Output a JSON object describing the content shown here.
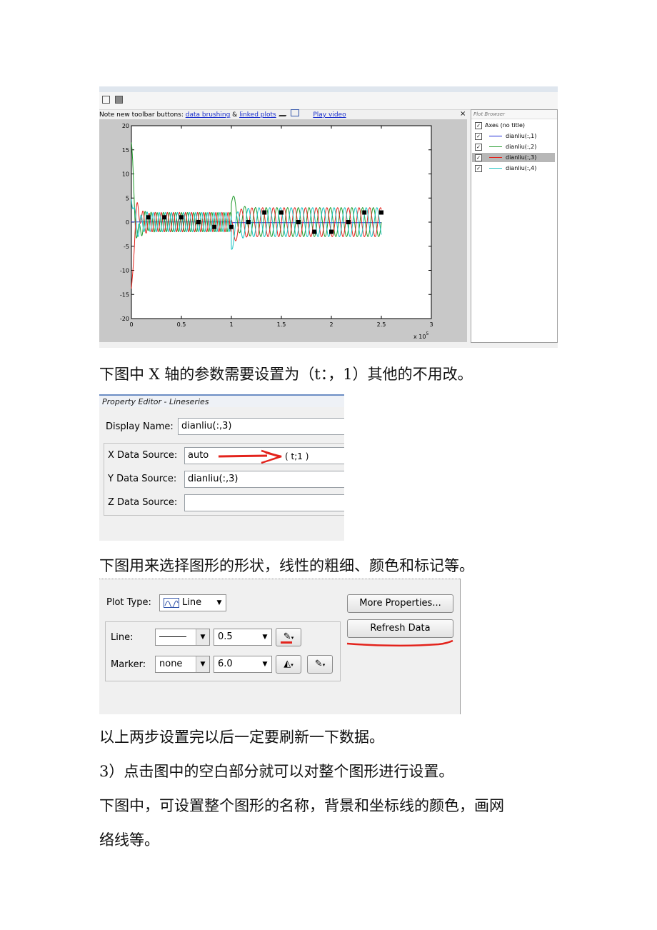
{
  "screenshot1": {
    "toolbar_note": "Note new toolbar buttons: ",
    "link_brushing": "data brushing",
    "amp": "&",
    "link_linked": "linked plots",
    "link_video": "Play video",
    "close_glyph": "×",
    "browser_title": "Plot Browser",
    "browser_items": [
      {
        "label": "Axes (no title)"
      },
      {
        "label": "dianliu(:,1)",
        "color": "#1f2bd6"
      },
      {
        "label": "dianliu(:,2)",
        "color": "#1f9a2a"
      },
      {
        "label": "dianliu(:,3)",
        "color": "#e3231c",
        "selected": true
      },
      {
        "label": "dianliu(:,4)",
        "color": "#19c2c2"
      }
    ],
    "chart_data": {
      "type": "line",
      "xlim": [
        0,
        3
      ],
      "ylim": [
        -20,
        20
      ],
      "x_ticks": [
        "0",
        "0.5",
        "1",
        "1.5",
        "2",
        "2.5",
        "3"
      ],
      "y_ticks": [
        "20",
        "15",
        "10",
        "5",
        "0",
        "-5",
        "-10",
        "-15",
        "-20"
      ],
      "x_multiplier": "x 10",
      "x_multiplier_exp": "5",
      "grid": false,
      "series": [
        {
          "name": "dianliu(:,1)",
          "color": "#1f2bd6",
          "segments": [
            [
              0,
              0.01
            ],
            [
              0.01,
              0.05
            ],
            [
              1.0,
              0.05
            ],
            [
              1.01,
              -0.1
            ],
            [
              2.5,
              -0.1
            ]
          ]
        },
        {
          "name": "dianliu(:,2)",
          "color": "#1f9a2a",
          "transient_peaks": [
            [
              0.07,
              16.5
            ],
            [
              1.05,
              6.5
            ]
          ],
          "steady_amplitude_1": 2,
          "steady_amplitude_2": 3
        },
        {
          "name": "dianliu(:,3)",
          "color": "#e3231c",
          "transient_peaks": [
            [
              0.04,
              -15.5
            ],
            [
              0.12,
              7.5
            ],
            [
              1.02,
              -3.5
            ]
          ],
          "steady_amplitude_1": 2,
          "steady_amplitude_2": 3
        },
        {
          "name": "dianliu(:,4)",
          "color": "#19c2c2",
          "transient_peaks": [
            [
              0.02,
              6.5
            ],
            [
              0.1,
              -11
            ],
            [
              1.07,
              -5
            ]
          ],
          "steady_amplitude_1": 2,
          "steady_amplitude_2": 3
        }
      ],
      "x_end": 2.5
    }
  },
  "para1": "下图中 X 轴的参数需要设置为（t：，1）其他的不用改。",
  "screenshot2": {
    "title": "Property Editor - Lineseries",
    "display_name_label": "Display Name:",
    "display_name_value": "dianliu(:,3)",
    "x_label": "X Data Source:",
    "x_value": "auto",
    "x_annotation": "( t;1 )",
    "y_label": "Y Data Source:",
    "y_value": "dianliu(:,3)",
    "z_label": "Z Data Source:",
    "z_value": ""
  },
  "para2": "下图用来选择图形的形状，线性的粗细、颜色和标记等。",
  "screenshot3": {
    "plot_type_label": "Plot Type:",
    "plot_type_value": "Line",
    "line_label": "Line:",
    "line_width": "0.5",
    "marker_label": "Marker:",
    "marker_value": "none",
    "marker_size": "6.0",
    "more_properties": "More Properties...",
    "refresh_data": "Refresh Data",
    "annotation_color": "#e3231c"
  },
  "para3": "以上两步设置完以后一定要刷新一下数据。",
  "para4": "3）点击图中的空白部分就可以对整个图形进行设置。",
  "para5": "下图中，可设置整个图形的名称，背景和坐标线的颜色，画网",
  "para6": "络线等。"
}
